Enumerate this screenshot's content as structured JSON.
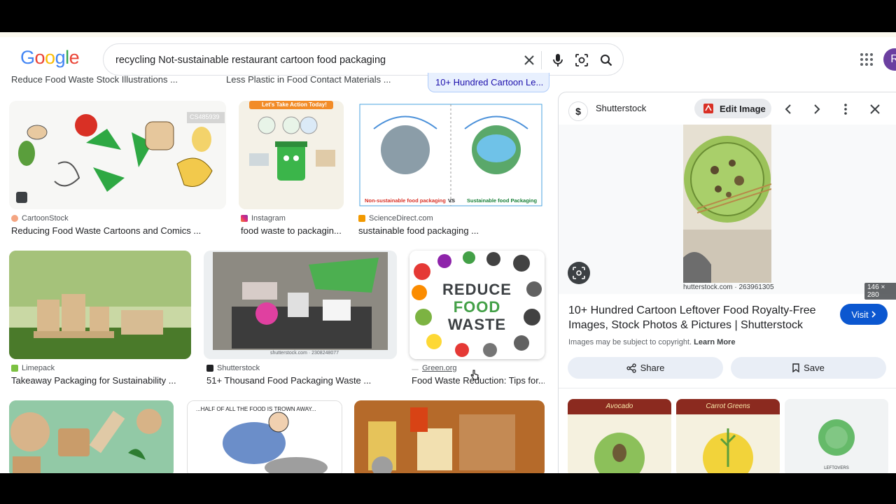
{
  "search": {
    "query": "recycling Not-sustainable restaurant cartoon food packaging"
  },
  "logo": [
    "G",
    "o",
    "o",
    "g",
    "l",
    "e"
  ],
  "logo_colors": [
    "#4285f4",
    "#ea4335",
    "#fbbc05",
    "#4285f4",
    "#34a853",
    "#ea4335"
  ],
  "avatar_letter": "R",
  "partial_row": {
    "caption1": "Reduce Food Waste Stock Illustrations ...",
    "caption2": "Less Plastic in Food Contact Materials ...",
    "caption3": "10+ Hundred Cartoon Le..."
  },
  "results": [
    {
      "source": "CartoonStock",
      "caption": "Reducing Food Waste Cartoons and Comics ...",
      "badge": "CS485939"
    },
    {
      "source": "Instagram",
      "caption": "food waste to packagin...",
      "poster_title": "Let's Take Action Today!"
    },
    {
      "source": "ScienceDirect.com",
      "caption": "sustainable food packaging ...",
      "left_label": "Non-sustainable food packaging",
      "vs": "VS",
      "right_label": "Sustainable food Packaging"
    },
    {
      "source": "Limepack",
      "caption": "Takeaway Packaging for Sustainability ..."
    },
    {
      "source": "Shutterstock",
      "caption": "51+ Thousand Food Packaging Waste ...",
      "credit": "shutterstock.com · 2308248077"
    },
    {
      "source": "Green.org",
      "caption": "Food Waste Reduction: Tips for...",
      "poster_line1": "REDUCE",
      "poster_line2": "FOOD",
      "poster_line3": "WASTE"
    },
    {
      "caption_art": "...HALF OF ALL THE FOOD IS TROWN AWAY..."
    }
  ],
  "panel": {
    "site": "Shutterstock",
    "edit_label": "Edit Image",
    "credit": "hutterstock.com · 263961305",
    "dimensions": "146 × 280",
    "title": "10+ Hundred Cartoon Leftover Food Royalty-Free Images, Stock Photos & Pictures | Shutterstock",
    "visit_label": "Visit",
    "copyright": "Images may be subject to copyright.",
    "learn_more": "Learn More",
    "share_label": "Share",
    "save_label": "Save",
    "related": [
      {
        "label": "Avocado"
      },
      {
        "label": "Carrot Greens"
      },
      {
        "label": "LEFTOVERS"
      }
    ]
  }
}
